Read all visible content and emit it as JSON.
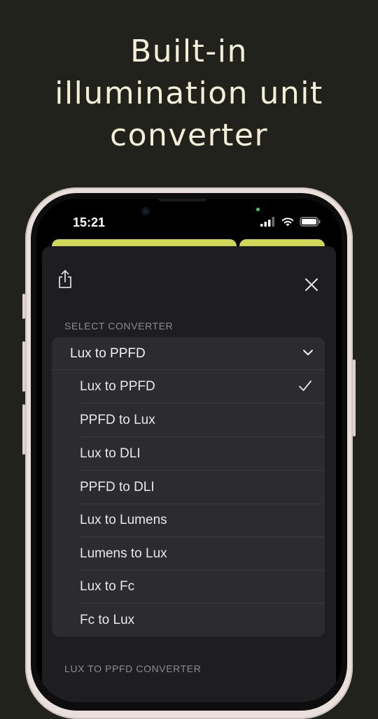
{
  "headline": {
    "line1": "Built-in",
    "line2": "illumination unit",
    "line3": "converter"
  },
  "status_bar": {
    "time": "15:21"
  },
  "sheet": {
    "select_label": "SELECT CONVERTER",
    "selected_value": "Lux to PPFD",
    "options": [
      "Lux to PPFD",
      "PPFD to Lux",
      "Lux to DLI",
      "PPFD to DLI",
      "Lux to Lumens",
      "Lumens to Lux",
      "Lux to Fc",
      "Fc to Lux"
    ],
    "checked_option": "Lux to PPFD",
    "next_section_label": "LUX TO PPFD CONVERTER"
  },
  "colors": {
    "background": "#22221d",
    "headline_text": "#f4efd8",
    "accent_yellow": "#cfd65a",
    "sheet": "#1e1e21",
    "dropdown": "#2c2c2f"
  },
  "icons": [
    "share-icon",
    "close-icon",
    "chevron-down-icon",
    "checkmark-icon",
    "signal-icon",
    "wifi-icon",
    "battery-icon"
  ]
}
